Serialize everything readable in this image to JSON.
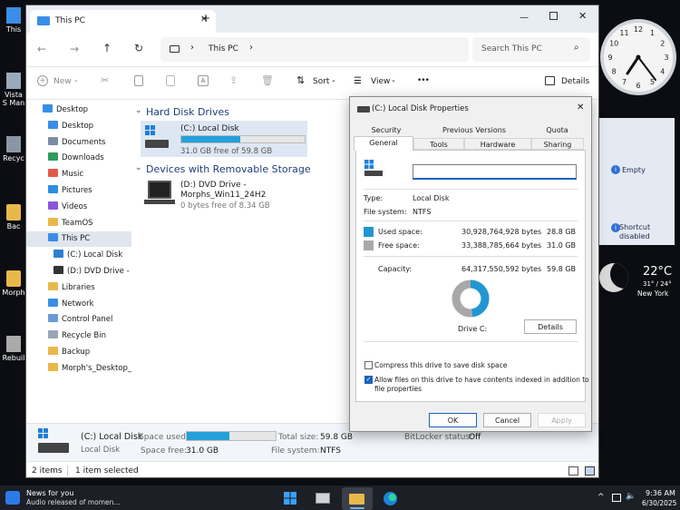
{
  "desktop": {
    "icons": [
      {
        "label": "This",
        "name": "this-pc"
      },
      {
        "label": "Vista S Man",
        "name": "vista-shortcut"
      },
      {
        "label": "Recyc",
        "name": "recycle-bin"
      },
      {
        "label": "Bac",
        "name": "backup"
      },
      {
        "label": "Morph",
        "name": "morphs-desktop"
      },
      {
        "label": "Rebuil",
        "name": "rebuild"
      }
    ]
  },
  "explorer": {
    "tab_title": "This PC",
    "new_tab_symbol": "+",
    "address_path": "This PC",
    "search_placeholder": "Search This PC",
    "cmd": {
      "new": "New",
      "sort": "Sort",
      "view": "View",
      "more": "•••",
      "details": "Details"
    },
    "nav": [
      {
        "label": "Desktop",
        "name": "desktop",
        "indent": 0,
        "icon": "#3a8ee6"
      },
      {
        "label": "Desktop",
        "name": "desktop-quick",
        "indent": 1,
        "icon": "#3a8ee6"
      },
      {
        "label": "Documents",
        "name": "documents",
        "indent": 1,
        "icon": "#7a8ca3"
      },
      {
        "label": "Downloads",
        "name": "downloads",
        "indent": 1,
        "icon": "#2e9c5c"
      },
      {
        "label": "Music",
        "name": "music",
        "indent": 1,
        "icon": "#e25b49"
      },
      {
        "label": "Pictures",
        "name": "pictures",
        "indent": 1,
        "icon": "#2d8fe0"
      },
      {
        "label": "Videos",
        "name": "videos",
        "indent": 1,
        "icon": "#8a56d8"
      },
      {
        "label": "TeamOS",
        "name": "teamos",
        "indent": 1,
        "icon": "#e8b94a"
      },
      {
        "label": "This PC",
        "name": "this-pc",
        "indent": 1,
        "icon": "#3a8ee6",
        "selected": true
      },
      {
        "label": "(C:) Local Disk",
        "name": "local-disk-c",
        "indent": 2,
        "icon": "#2d7fd1"
      },
      {
        "label": "(D:) DVD Drive - M",
        "name": "dvd-drive-d",
        "indent": 2,
        "icon": "#333"
      },
      {
        "label": "Libraries",
        "name": "libraries",
        "indent": 1,
        "icon": "#e8b94a"
      },
      {
        "label": "Network",
        "name": "network",
        "indent": 1,
        "icon": "#3a8ee6"
      },
      {
        "label": "Control Panel",
        "name": "control-panel",
        "indent": 1,
        "icon": "#6a9bd8"
      },
      {
        "label": "Recycle Bin",
        "name": "recycle-bin",
        "indent": 1,
        "icon": "#9aa6b5"
      },
      {
        "label": "Backup",
        "name": "backup",
        "indent": 1,
        "icon": "#e8b94a"
      },
      {
        "label": "Morph's_Desktop_A",
        "name": "morphs-desktop",
        "indent": 1,
        "icon": "#e8b94a"
      }
    ],
    "groups": {
      "hdd": "Hard Disk Drives",
      "removable": "Devices with Removable Storage"
    },
    "drive_c": {
      "name": "(C:) Local Disk",
      "free": "31.0 GB free of 59.8 GB",
      "used_fraction": 0.48
    },
    "drive_d": {
      "name": "(D:) DVD Drive -",
      "name2": "Morphs_Win11_24H2",
      "free": "0 bytes free of 8.34 GB"
    },
    "details_pane": {
      "name": "(C:) Local Disk",
      "type": "Local Disk",
      "space_used_label": "Space used:",
      "space_free_label": "Space free:",
      "space_free": "31.0 GB",
      "total_size_label": "Total size:",
      "total_size": "59.8 GB",
      "fs_label": "File system:",
      "fs": "NTFS",
      "bitlocker_label": "BitLocker status:",
      "bitlocker": "Off",
      "used_fraction": 0.48
    },
    "status": {
      "items": "2 items",
      "selected": "1 item selected"
    }
  },
  "props": {
    "title": "(C:) Local Disk Properties",
    "tabs_row1": [
      "Security",
      "Previous Versions",
      "Quota"
    ],
    "tabs_row2": [
      "General",
      "Tools",
      "Hardware",
      "Sharing"
    ],
    "type_label": "Type:",
    "type": "Local Disk",
    "fs_label": "File system:",
    "fs": "NTFS",
    "used_label": "Used space:",
    "used_bytes": "30,928,764,928 bytes",
    "used_gb": "28.8 GB",
    "free_label": "Free space:",
    "free_bytes": "33,388,785,664 bytes",
    "free_gb": "31.0 GB",
    "cap_label": "Capacity:",
    "cap_bytes": "64,317,550,592 bytes",
    "cap_gb": "59.8 GB",
    "drive_label": "Drive C:",
    "details_btn": "Details",
    "compress": "Compress this drive to save disk space",
    "index_line1": "Allow files on this drive to have contents indexed in addition to",
    "index_line2": "file properties",
    "ok": "OK",
    "cancel": "Cancel",
    "apply": "Apply",
    "used_color": "#2196d3",
    "free_color": "#a8a8a8",
    "used_fraction": 0.481
  },
  "gadgets": {
    "clock_numbers": [
      "12",
      "1",
      "2",
      "3",
      "4",
      "5",
      "6",
      "7",
      "8",
      "9",
      "10",
      "11"
    ],
    "empty": "Empty",
    "shortcut1": "Shortcut",
    "shortcut2": "disabled",
    "temp": "22°C",
    "range": "31° / 24°",
    "city": "New York"
  },
  "taskbar": {
    "news_title": "News for you",
    "news_sub": "Audio released of momen...",
    "chevron": "^",
    "time": "9:36 AM",
    "date": "6/30/2025"
  }
}
